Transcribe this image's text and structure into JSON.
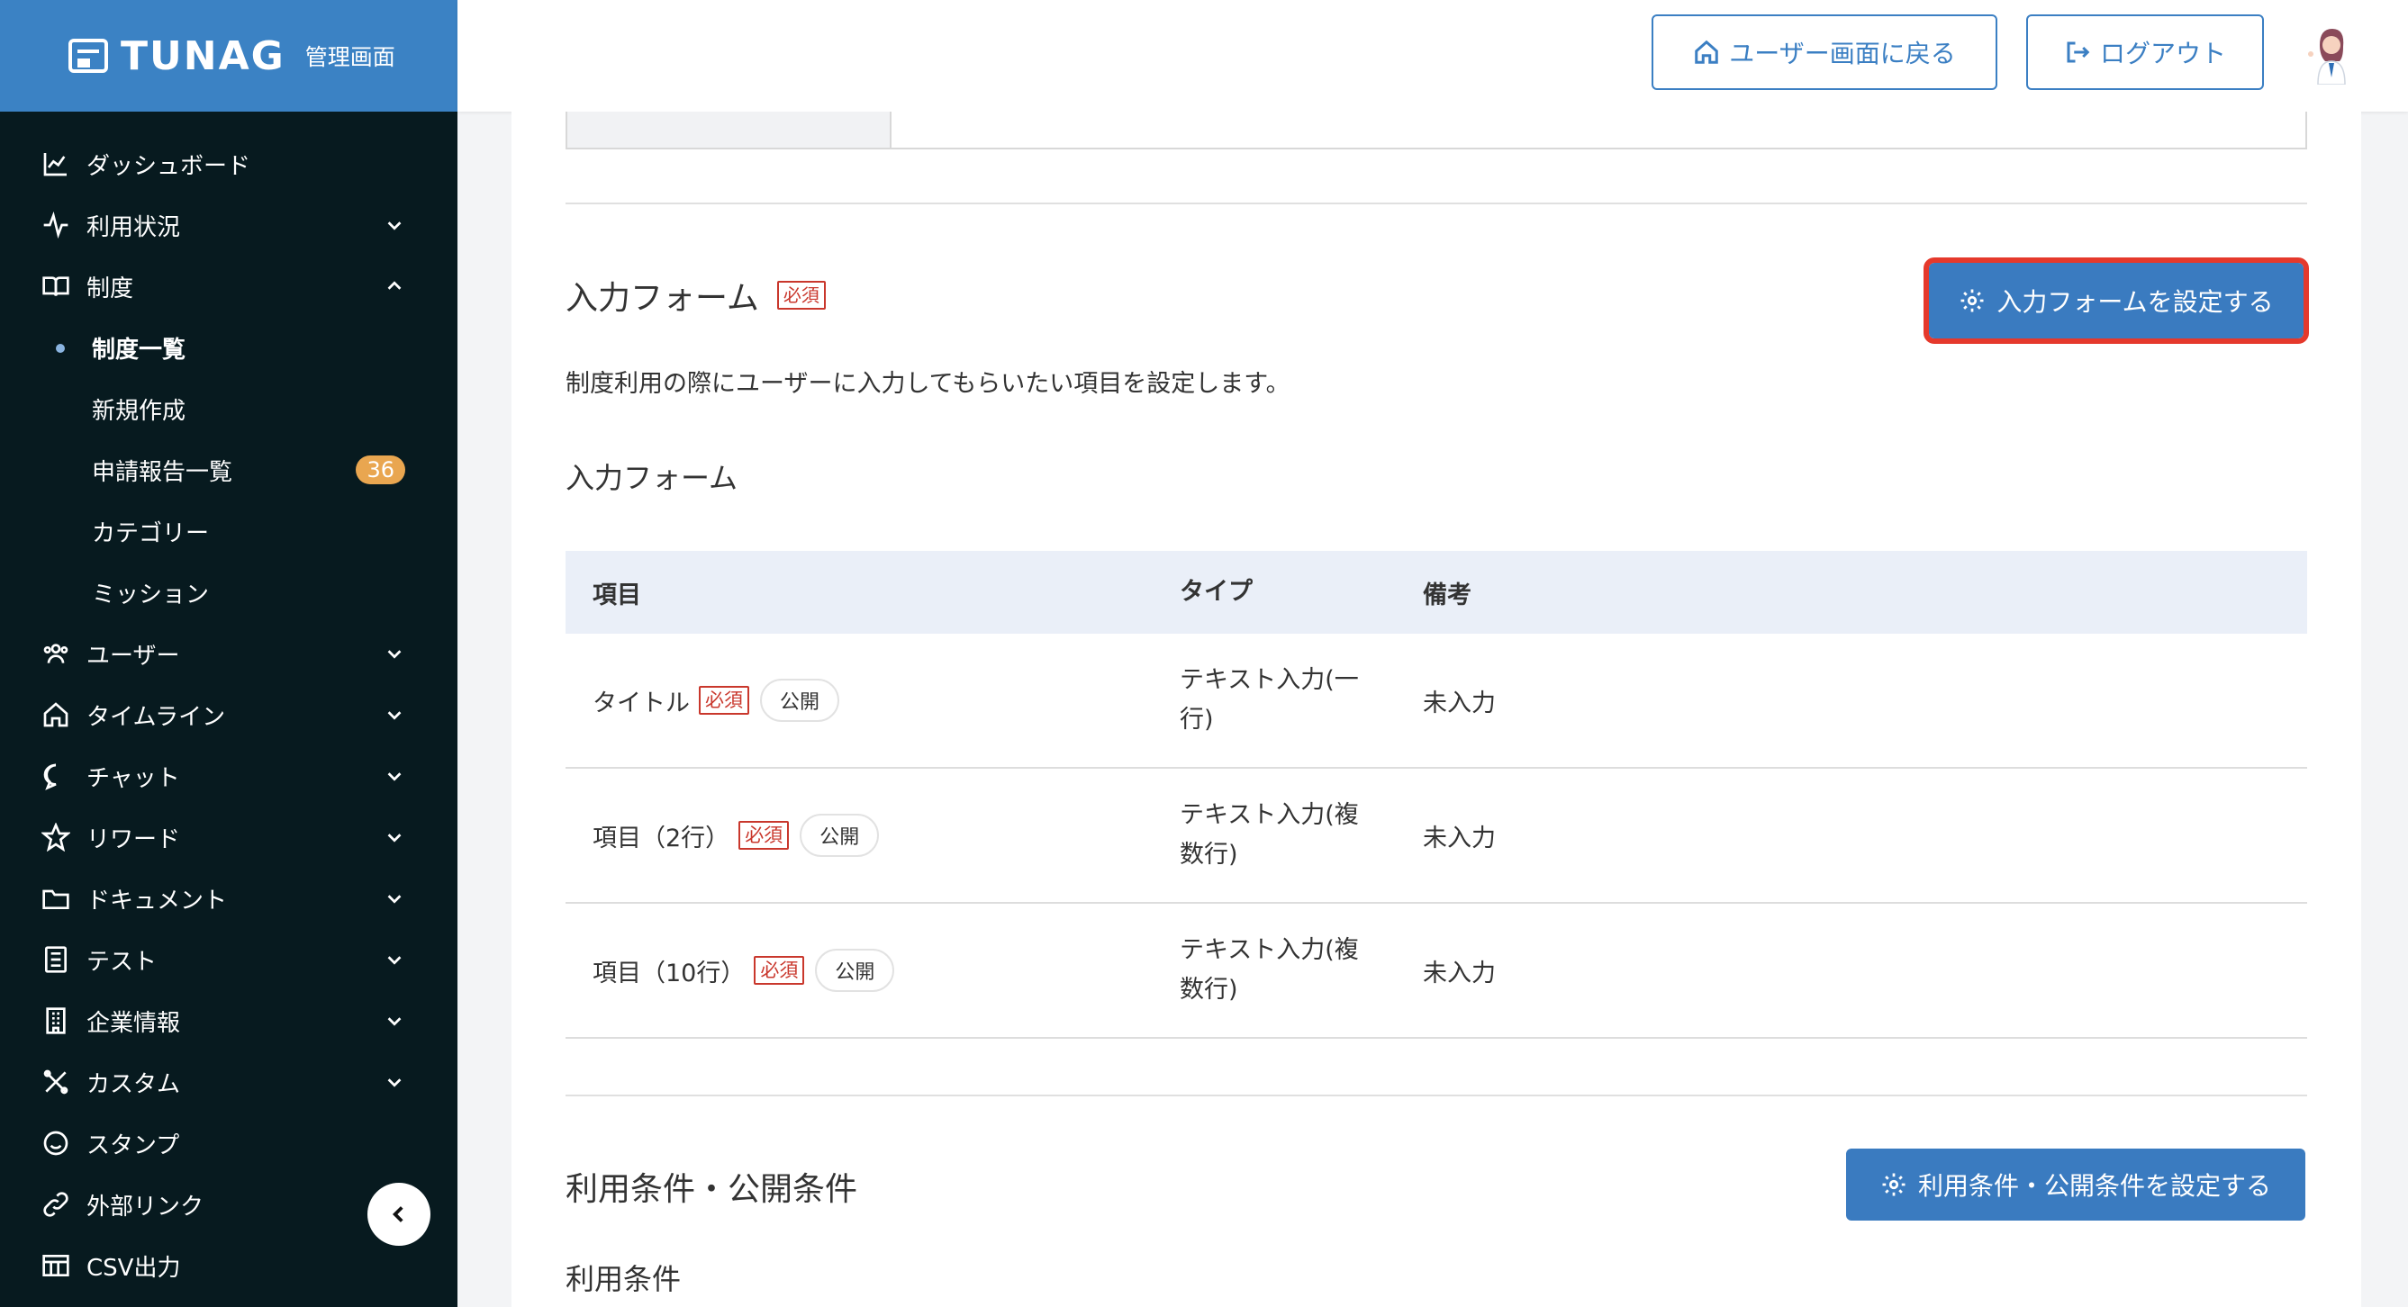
{
  "brand": {
    "name": "TUNAG",
    "subtitle": "管理画面"
  },
  "sidebar": {
    "items": [
      {
        "label": "ダッシュボード",
        "icon": "chart-icon",
        "chevron": ""
      },
      {
        "label": "利用状況",
        "icon": "activity-icon",
        "chevron": "down"
      },
      {
        "label": "制度",
        "icon": "book-icon",
        "chevron": "up"
      },
      {
        "label": "ユーザー",
        "icon": "users-icon",
        "chevron": "down"
      },
      {
        "label": "タイムライン",
        "icon": "home-icon",
        "chevron": "down"
      },
      {
        "label": "チャット",
        "icon": "chat-icon",
        "chevron": "down"
      },
      {
        "label": "リワード",
        "icon": "star-icon",
        "chevron": "down"
      },
      {
        "label": "ドキュメント",
        "icon": "folder-icon",
        "chevron": "down"
      },
      {
        "label": "テスト",
        "icon": "list-icon",
        "chevron": "down"
      },
      {
        "label": "企業情報",
        "icon": "building-icon",
        "chevron": "down"
      },
      {
        "label": "カスタム",
        "icon": "tools-icon",
        "chevron": "down"
      },
      {
        "label": "スタンプ",
        "icon": "smile-icon",
        "chevron": ""
      },
      {
        "label": "外部リンク",
        "icon": "link-icon",
        "chevron": ""
      },
      {
        "label": "CSV出力",
        "icon": "table-icon",
        "chevron": ""
      }
    ],
    "sub_items": [
      {
        "label": "制度一覧",
        "active": true
      },
      {
        "label": "新規作成"
      },
      {
        "label": "申請報告一覧",
        "badge": "36"
      },
      {
        "label": "カテゴリー"
      },
      {
        "label": "ミッション"
      }
    ]
  },
  "header": {
    "home_label": "ユーザー画面に戻る",
    "logout_label": "ログアウト"
  },
  "form_section": {
    "title": "入力フォーム",
    "required": "必須",
    "button_label": "入力フォームを設定する",
    "description": "制度利用の際にユーザーに入力してもらいたい項目を設定します。",
    "subtitle": "入力フォーム",
    "columns": [
      "項目",
      "タイプ",
      "備考"
    ],
    "rows": [
      {
        "name": "タイトル",
        "required": "必須",
        "visibility": "公開",
        "type_line1": "テキスト入力(一",
        "type_line2": "行)",
        "note": "未入力"
      },
      {
        "name": "項目（2行）",
        "required": "必須",
        "visibility": "公開",
        "type_line1": "テキスト入力(複",
        "type_line2": "数行)",
        "note": "未入力"
      },
      {
        "name": "項目（10行）",
        "required": "必須",
        "visibility": "公開",
        "type_line1": "テキスト入力(複",
        "type_line2": "数行)",
        "note": "未入力"
      }
    ]
  },
  "condition_section": {
    "title": "利用条件・公開条件",
    "button_label": "利用条件・公開条件を設定する",
    "subtitle": "利用条件"
  },
  "colors": {
    "brand": "#3b82c4",
    "sidebar_bg": "#071a1f",
    "accent": "#3a7bc0",
    "required": "#c9372c",
    "badge": "#e9a650",
    "highlight": "#e5392c"
  }
}
